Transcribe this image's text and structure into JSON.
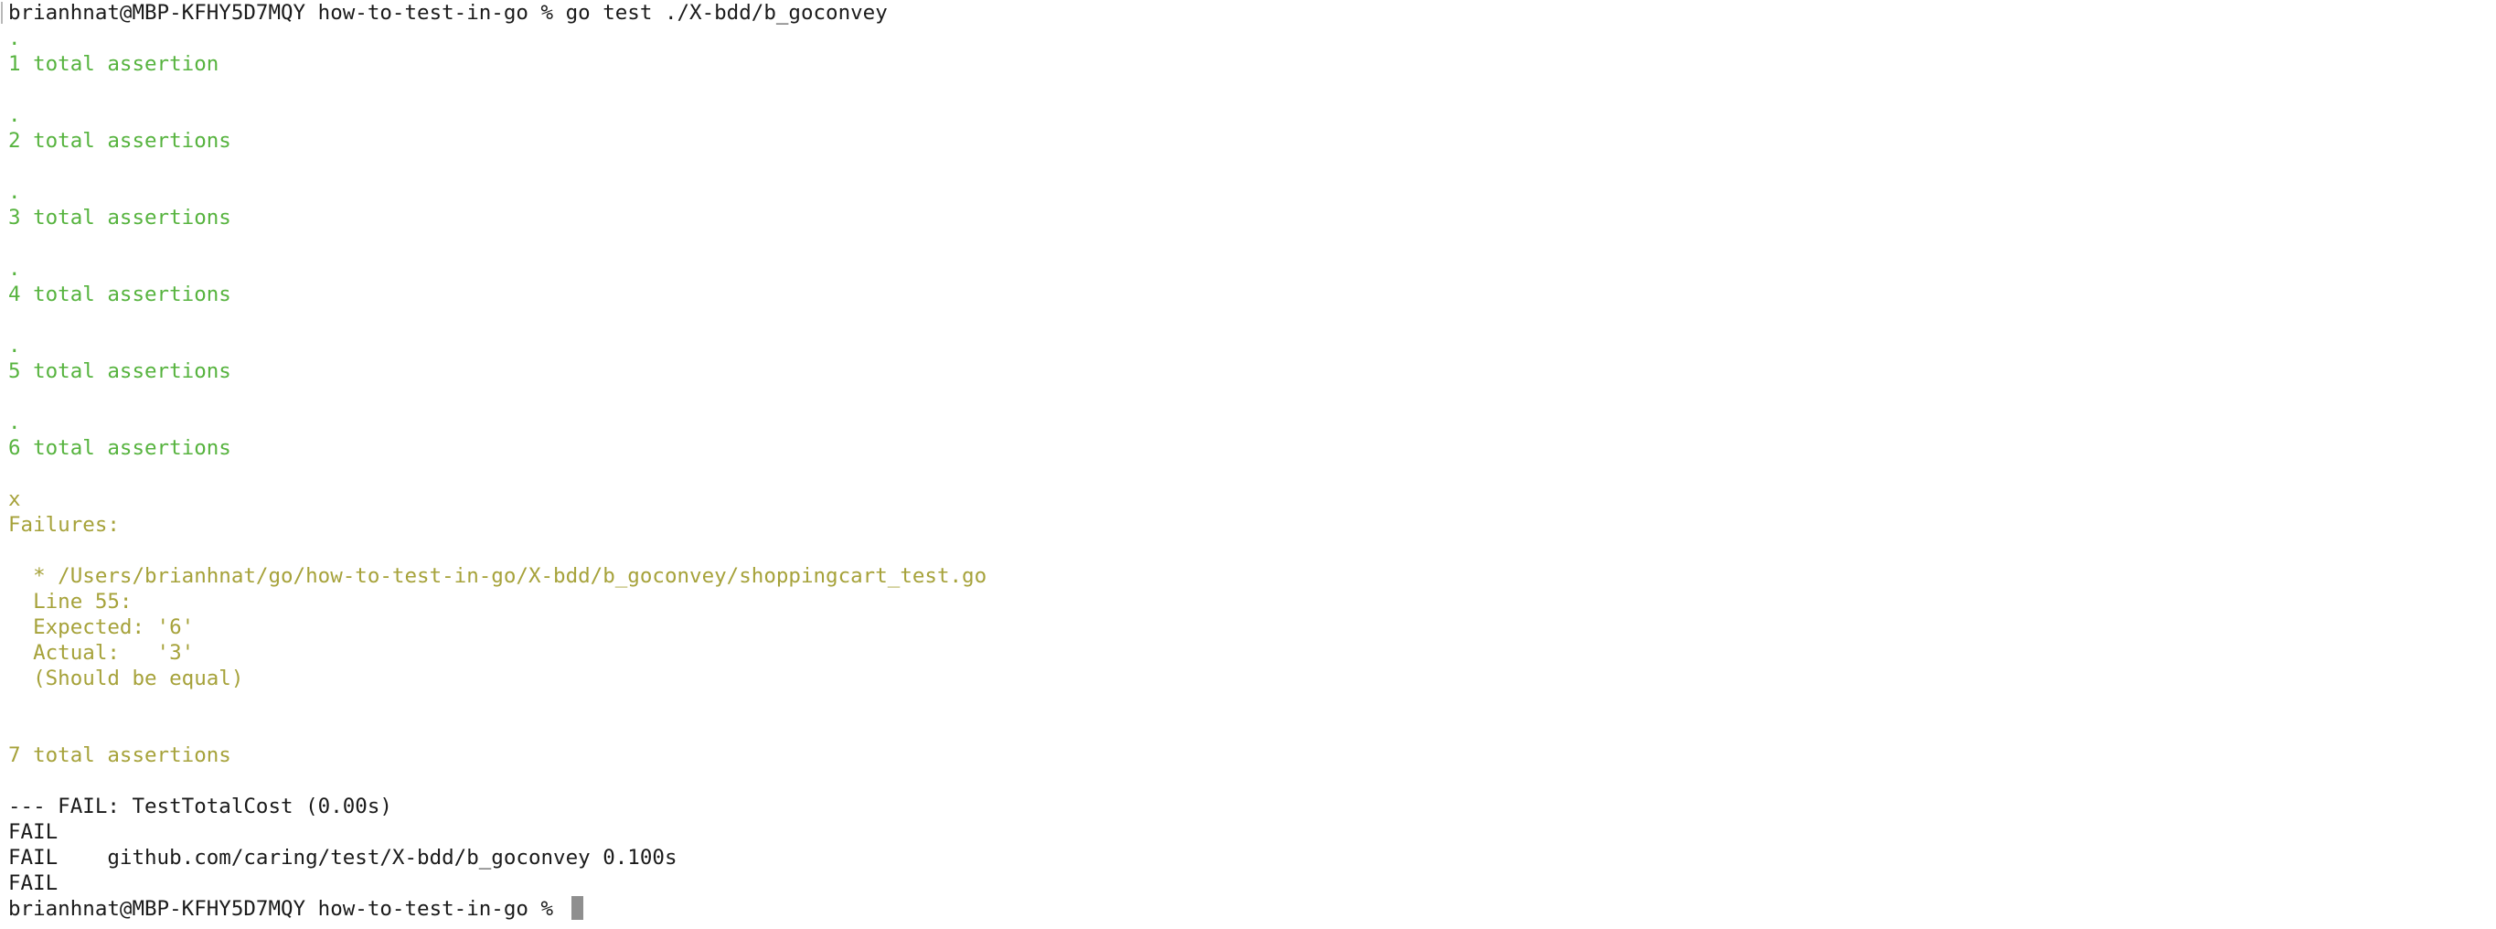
{
  "terminal": {
    "lines": [
      {
        "text": "brianhnat@MBP-KFHY5D7MQY how-to-test-in-go % go test ./X-bdd/b_goconvey",
        "color": "#1a1a1a"
      },
      {
        "text": ".",
        "color": "#56b33e"
      },
      {
        "text": "1 total assertion",
        "color": "#56b33e"
      },
      {
        "text": "",
        "color": "#56b33e"
      },
      {
        "text": ".",
        "color": "#56b33e"
      },
      {
        "text": "2 total assertions",
        "color": "#56b33e"
      },
      {
        "text": "",
        "color": "#56b33e"
      },
      {
        "text": ".",
        "color": "#56b33e"
      },
      {
        "text": "3 total assertions",
        "color": "#56b33e"
      },
      {
        "text": "",
        "color": "#56b33e"
      },
      {
        "text": ".",
        "color": "#56b33e"
      },
      {
        "text": "4 total assertions",
        "color": "#56b33e"
      },
      {
        "text": "",
        "color": "#56b33e"
      },
      {
        "text": ".",
        "color": "#56b33e"
      },
      {
        "text": "5 total assertions",
        "color": "#56b33e"
      },
      {
        "text": "",
        "color": "#56b33e"
      },
      {
        "text": ".",
        "color": "#56b33e"
      },
      {
        "text": "6 total assertions",
        "color": "#56b33e"
      },
      {
        "text": "",
        "color": "#56b33e"
      },
      {
        "text": "x",
        "color": "#a6a23a"
      },
      {
        "text": "Failures:",
        "color": "#a6a23a"
      },
      {
        "text": "",
        "color": "#a6a23a"
      },
      {
        "text": "  * /Users/brianhnat/go/how-to-test-in-go/X-bdd/b_goconvey/shoppingcart_test.go",
        "color": "#a6a23a"
      },
      {
        "text": "  Line 55:",
        "color": "#a6a23a"
      },
      {
        "text": "  Expected: '6'",
        "color": "#a6a23a"
      },
      {
        "text": "  Actual:   '3'",
        "color": "#a6a23a"
      },
      {
        "text": "  (Should be equal)",
        "color": "#a6a23a"
      },
      {
        "text": "",
        "color": "#a6a23a"
      },
      {
        "text": "",
        "color": "#a6a23a"
      },
      {
        "text": "7 total assertions",
        "color": "#a6a23a"
      },
      {
        "text": "",
        "color": "#1a1a1a"
      },
      {
        "text": "--- FAIL: TestTotalCost (0.00s)",
        "color": "#1a1a1a"
      },
      {
        "text": "FAIL",
        "color": "#1a1a1a"
      },
      {
        "text": "FAIL    github.com/caring/test/X-bdd/b_goconvey 0.100s",
        "color": "#1a1a1a"
      },
      {
        "text": "FAIL",
        "color": "#1a1a1a"
      },
      {
        "text": "brianhnat@MBP-KFHY5D7MQY how-to-test-in-go % ",
        "color": "#1a1a1a"
      }
    ]
  }
}
